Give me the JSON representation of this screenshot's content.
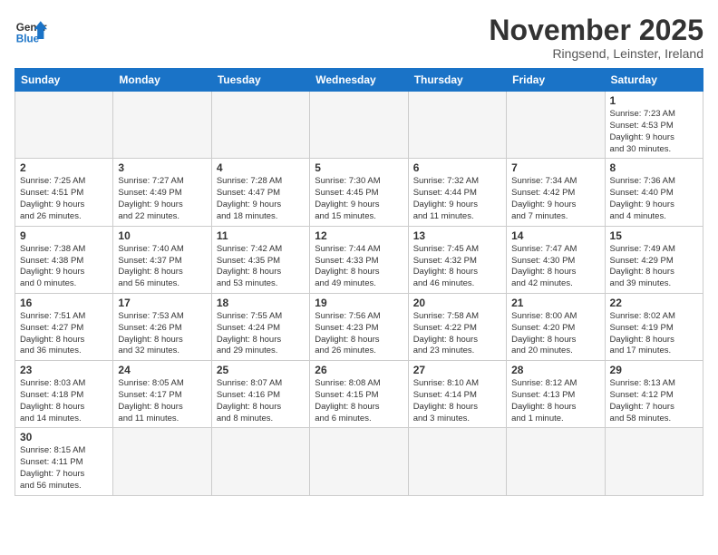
{
  "logo": {
    "general": "General",
    "blue": "Blue"
  },
  "title": "November 2025",
  "location": "Ringsend, Leinster, Ireland",
  "weekdays": [
    "Sunday",
    "Monday",
    "Tuesday",
    "Wednesday",
    "Thursday",
    "Friday",
    "Saturday"
  ],
  "weeks": [
    [
      {
        "day": "",
        "info": ""
      },
      {
        "day": "",
        "info": ""
      },
      {
        "day": "",
        "info": ""
      },
      {
        "day": "",
        "info": ""
      },
      {
        "day": "",
        "info": ""
      },
      {
        "day": "",
        "info": ""
      },
      {
        "day": "1",
        "info": "Sunrise: 7:23 AM\nSunset: 4:53 PM\nDaylight: 9 hours\nand 30 minutes."
      }
    ],
    [
      {
        "day": "2",
        "info": "Sunrise: 7:25 AM\nSunset: 4:51 PM\nDaylight: 9 hours\nand 26 minutes."
      },
      {
        "day": "3",
        "info": "Sunrise: 7:27 AM\nSunset: 4:49 PM\nDaylight: 9 hours\nand 22 minutes."
      },
      {
        "day": "4",
        "info": "Sunrise: 7:28 AM\nSunset: 4:47 PM\nDaylight: 9 hours\nand 18 minutes."
      },
      {
        "day": "5",
        "info": "Sunrise: 7:30 AM\nSunset: 4:45 PM\nDaylight: 9 hours\nand 15 minutes."
      },
      {
        "day": "6",
        "info": "Sunrise: 7:32 AM\nSunset: 4:44 PM\nDaylight: 9 hours\nand 11 minutes."
      },
      {
        "day": "7",
        "info": "Sunrise: 7:34 AM\nSunset: 4:42 PM\nDaylight: 9 hours\nand 7 minutes."
      },
      {
        "day": "8",
        "info": "Sunrise: 7:36 AM\nSunset: 4:40 PM\nDaylight: 9 hours\nand 4 minutes."
      }
    ],
    [
      {
        "day": "9",
        "info": "Sunrise: 7:38 AM\nSunset: 4:38 PM\nDaylight: 9 hours\nand 0 minutes."
      },
      {
        "day": "10",
        "info": "Sunrise: 7:40 AM\nSunset: 4:37 PM\nDaylight: 8 hours\nand 56 minutes."
      },
      {
        "day": "11",
        "info": "Sunrise: 7:42 AM\nSunset: 4:35 PM\nDaylight: 8 hours\nand 53 minutes."
      },
      {
        "day": "12",
        "info": "Sunrise: 7:44 AM\nSunset: 4:33 PM\nDaylight: 8 hours\nand 49 minutes."
      },
      {
        "day": "13",
        "info": "Sunrise: 7:45 AM\nSunset: 4:32 PM\nDaylight: 8 hours\nand 46 minutes."
      },
      {
        "day": "14",
        "info": "Sunrise: 7:47 AM\nSunset: 4:30 PM\nDaylight: 8 hours\nand 42 minutes."
      },
      {
        "day": "15",
        "info": "Sunrise: 7:49 AM\nSunset: 4:29 PM\nDaylight: 8 hours\nand 39 minutes."
      }
    ],
    [
      {
        "day": "16",
        "info": "Sunrise: 7:51 AM\nSunset: 4:27 PM\nDaylight: 8 hours\nand 36 minutes."
      },
      {
        "day": "17",
        "info": "Sunrise: 7:53 AM\nSunset: 4:26 PM\nDaylight: 8 hours\nand 32 minutes."
      },
      {
        "day": "18",
        "info": "Sunrise: 7:55 AM\nSunset: 4:24 PM\nDaylight: 8 hours\nand 29 minutes."
      },
      {
        "day": "19",
        "info": "Sunrise: 7:56 AM\nSunset: 4:23 PM\nDaylight: 8 hours\nand 26 minutes."
      },
      {
        "day": "20",
        "info": "Sunrise: 7:58 AM\nSunset: 4:22 PM\nDaylight: 8 hours\nand 23 minutes."
      },
      {
        "day": "21",
        "info": "Sunrise: 8:00 AM\nSunset: 4:20 PM\nDaylight: 8 hours\nand 20 minutes."
      },
      {
        "day": "22",
        "info": "Sunrise: 8:02 AM\nSunset: 4:19 PM\nDaylight: 8 hours\nand 17 minutes."
      }
    ],
    [
      {
        "day": "23",
        "info": "Sunrise: 8:03 AM\nSunset: 4:18 PM\nDaylight: 8 hours\nand 14 minutes."
      },
      {
        "day": "24",
        "info": "Sunrise: 8:05 AM\nSunset: 4:17 PM\nDaylight: 8 hours\nand 11 minutes."
      },
      {
        "day": "25",
        "info": "Sunrise: 8:07 AM\nSunset: 4:16 PM\nDaylight: 8 hours\nand 8 minutes."
      },
      {
        "day": "26",
        "info": "Sunrise: 8:08 AM\nSunset: 4:15 PM\nDaylight: 8 hours\nand 6 minutes."
      },
      {
        "day": "27",
        "info": "Sunrise: 8:10 AM\nSunset: 4:14 PM\nDaylight: 8 hours\nand 3 minutes."
      },
      {
        "day": "28",
        "info": "Sunrise: 8:12 AM\nSunset: 4:13 PM\nDaylight: 8 hours\nand 1 minute."
      },
      {
        "day": "29",
        "info": "Sunrise: 8:13 AM\nSunset: 4:12 PM\nDaylight: 7 hours\nand 58 minutes."
      }
    ],
    [
      {
        "day": "30",
        "info": "Sunrise: 8:15 AM\nSunset: 4:11 PM\nDaylight: 7 hours\nand 56 minutes."
      },
      {
        "day": "",
        "info": ""
      },
      {
        "day": "",
        "info": ""
      },
      {
        "day": "",
        "info": ""
      },
      {
        "day": "",
        "info": ""
      },
      {
        "day": "",
        "info": ""
      },
      {
        "day": "",
        "info": ""
      }
    ]
  ]
}
